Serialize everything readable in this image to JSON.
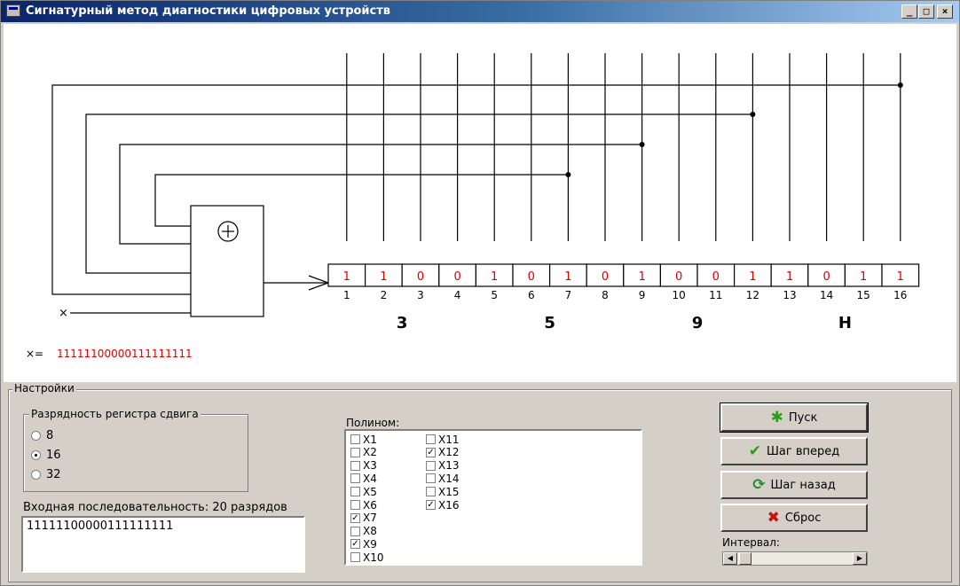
{
  "window": {
    "title": "Сигнатурный метод диагностики цифровых устройств",
    "minimize": "_",
    "maximize": "□",
    "close": "×"
  },
  "diagram": {
    "xor_symbol": "⊕",
    "input_label": "×",
    "register_bits": [
      "1",
      "1",
      "0",
      "0",
      "1",
      "0",
      "1",
      "0",
      "1",
      "0",
      "0",
      "1",
      "1",
      "0",
      "1",
      "1"
    ],
    "register_indices": [
      "1",
      "2",
      "3",
      "4",
      "5",
      "6",
      "7",
      "8",
      "9",
      "10",
      "11",
      "12",
      "13",
      "14",
      "15",
      "16"
    ],
    "signature": [
      "3",
      "5",
      "9",
      "H"
    ],
    "x_sequence_prefix": "×=",
    "x_sequence": "11111100000111111111",
    "tap_positions": [
      7,
      9,
      12,
      16
    ]
  },
  "settings": {
    "title": "Настройки",
    "bits_group": {
      "title": "Разрядность регистра сдвига",
      "options": [
        "8",
        "16",
        "32"
      ],
      "selected": "16"
    },
    "input_label": "Входная последовательность: 20 разрядов",
    "input_value": "11111100000111111111",
    "polynom_label": "Полином:",
    "polynom": [
      {
        "label": "X1",
        "checked": false
      },
      {
        "label": "X2",
        "checked": false
      },
      {
        "label": "X3",
        "checked": false
      },
      {
        "label": "X4",
        "checked": false
      },
      {
        "label": "X5",
        "checked": false
      },
      {
        "label": "X6",
        "checked": false
      },
      {
        "label": "X7",
        "checked": true
      },
      {
        "label": "X8",
        "checked": false
      },
      {
        "label": "X9",
        "checked": true
      },
      {
        "label": "X10",
        "checked": false
      },
      {
        "label": "X11",
        "checked": false
      },
      {
        "label": "X12",
        "checked": true
      },
      {
        "label": "X13",
        "checked": false
      },
      {
        "label": "X14",
        "checked": false
      },
      {
        "label": "X15",
        "checked": false
      },
      {
        "label": "X16",
        "checked": true
      }
    ],
    "buttons": {
      "start": "Пуск",
      "step_forward": "Шаг вперед",
      "step_back": "Шаг назад",
      "reset": "Сброс"
    },
    "interval_label": "Интервал:",
    "colors": {
      "bit_text": "#e00000",
      "ok_green": "#2e9a1e",
      "reset_red": "#cc1010",
      "step_back_green": "#1f8f2a"
    }
  }
}
